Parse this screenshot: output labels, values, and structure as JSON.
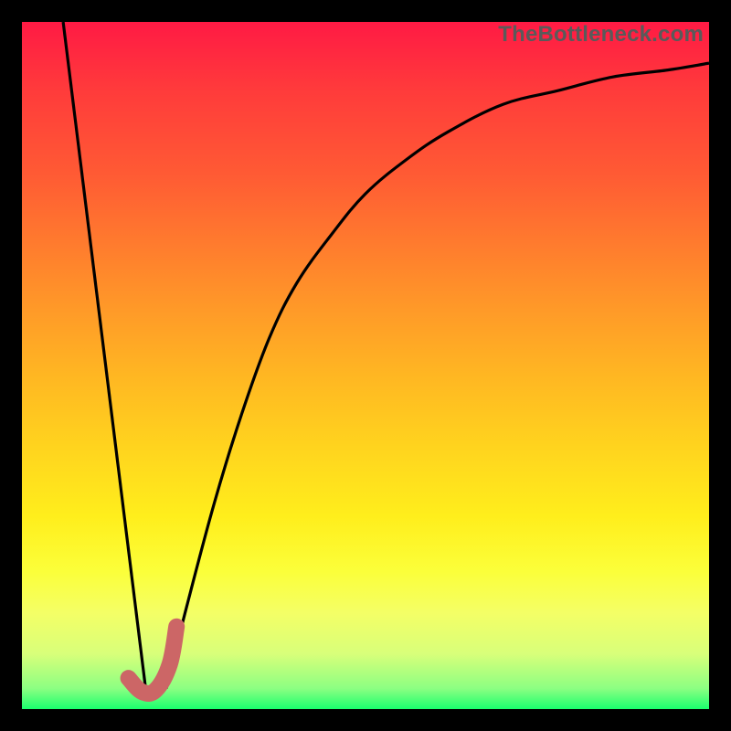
{
  "watermark": "TheBottleneck.com",
  "chart_data": {
    "type": "line",
    "title": "",
    "xlabel": "",
    "ylabel": "",
    "xlim": [
      0,
      100
    ],
    "ylim": [
      0,
      100
    ],
    "grid": false,
    "series": [
      {
        "name": "left-descent",
        "color": "#000000",
        "x": [
          6,
          18
        ],
        "y": [
          100,
          3
        ]
      },
      {
        "name": "right-curve",
        "color": "#000000",
        "x": [
          21,
          24,
          28,
          32,
          36,
          40,
          45,
          50,
          56,
          62,
          70,
          78,
          86,
          94,
          100
        ],
        "y": [
          3,
          15,
          30,
          43,
          54,
          62,
          69,
          75,
          80,
          84,
          88,
          90,
          92,
          93,
          94
        ]
      },
      {
        "name": "check-mark",
        "color": "#cc6666",
        "x": [
          15.5,
          17.5,
          19.5,
          21.5,
          22.5
        ],
        "y": [
          4.5,
          2.5,
          2.8,
          6.5,
          12
        ]
      }
    ],
    "gradient_stops": [
      {
        "pos": 0,
        "color": "#ff1a44"
      },
      {
        "pos": 10,
        "color": "#ff3b3b"
      },
      {
        "pos": 22,
        "color": "#ff5a34"
      },
      {
        "pos": 32,
        "color": "#ff7a2e"
      },
      {
        "pos": 42,
        "color": "#ff9a28"
      },
      {
        "pos": 52,
        "color": "#ffb822"
      },
      {
        "pos": 62,
        "color": "#ffd41e"
      },
      {
        "pos": 72,
        "color": "#ffee1c"
      },
      {
        "pos": 80,
        "color": "#fbff3a"
      },
      {
        "pos": 86,
        "color": "#f4ff66"
      },
      {
        "pos": 92,
        "color": "#d8ff7a"
      },
      {
        "pos": 97,
        "color": "#8cff82"
      },
      {
        "pos": 100,
        "color": "#1aff6e"
      }
    ]
  }
}
